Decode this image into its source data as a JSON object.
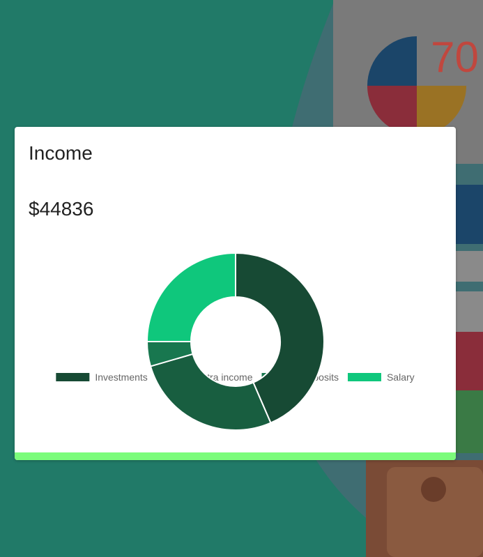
{
  "card": {
    "title": "Income",
    "total": "$44836",
    "accent_color": "#7bfc7b"
  },
  "background": {
    "decor_text": "70",
    "colors": [
      "#217a68",
      "#3f6d72",
      "#7a7a7a",
      "#1b4569",
      "#8a2d3a",
      "#9a7224",
      "#7a4b36"
    ]
  },
  "chart_data": {
    "type": "pie",
    "variant": "doughnut",
    "legend_position": "top",
    "series": [
      {
        "name": "Investments",
        "value": 43.5,
        "color": "#174a34"
      },
      {
        "name": "Extra income",
        "value": 27.0,
        "color": "#185e40"
      },
      {
        "name": "Deposits",
        "value": 4.5,
        "color": "#18774f"
      },
      {
        "name": "Salary",
        "value": 25.0,
        "color": "#0fc77c"
      }
    ]
  }
}
